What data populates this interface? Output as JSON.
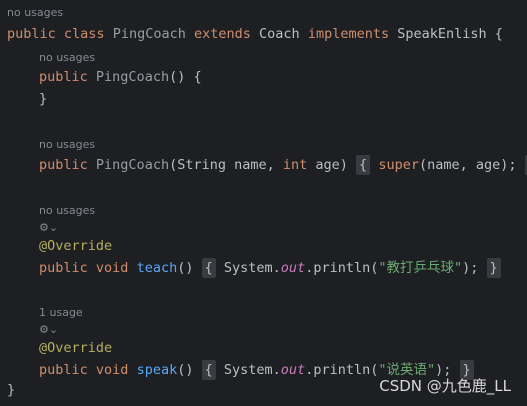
{
  "editor": {
    "hints": {
      "class_usages": "no usages",
      "ctor1_usages": "no usages",
      "ctor2_usages": "no usages",
      "teach_usages": "no usages",
      "speak_usages": "1 usage"
    },
    "code": {
      "public": "public",
      "class": "class",
      "extends": "extends",
      "implements": "implements",
      "class_name": "PingCoach",
      "super_class": "Coach",
      "interface_name": "SpeakEnlish",
      "open_brace": "{",
      "close_brace": "}",
      "ctor1_signature": "() {",
      "ctor2_params_open": "(String name, ",
      "int": "int",
      "ctor2_params_close": " age) ",
      "super": "super",
      "super_args": "(name, age);",
      "override": "@Override",
      "void": "void",
      "teach": "teach",
      "speak": "speak",
      "parens": "() ",
      "system": "System.",
      "out": "out",
      "println_open": ".println(",
      "teach_str": "\"教打乒乓球\"",
      "speak_str": "\"说英语\"",
      "println_close": ");"
    },
    "gear_glyph": "⚙⌄"
  },
  "watermark": "CSDN @九色鹿_LL"
}
